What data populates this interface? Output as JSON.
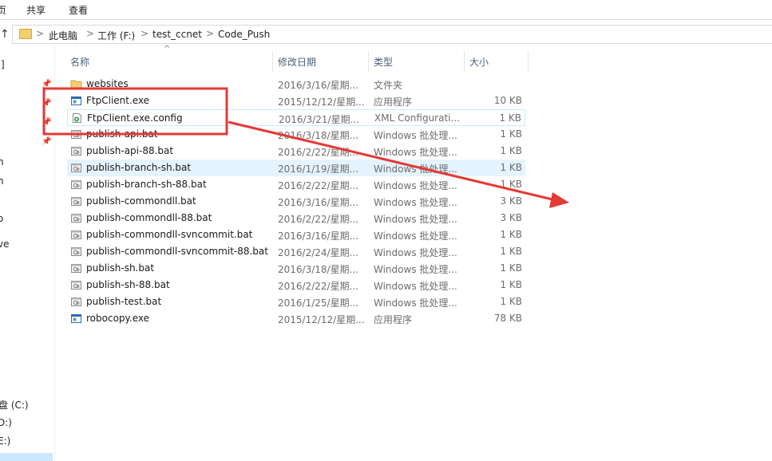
{
  "ribbon": {
    "tabs": [
      "页",
      "共享",
      "查看"
    ]
  },
  "address": {
    "up_glyph": "↑",
    "crumbs": [
      "此电脑",
      "工作 (F:)",
      "test_ccnet",
      "Code_Push"
    ],
    "separator": ">"
  },
  "nav": {
    "fragments": [
      "|]",
      "n",
      "n",
      "o",
      "ve",
      "盘 (C:)",
      "D:)",
      "E:)"
    ]
  },
  "columns": {
    "name": "名称",
    "date": "修改日期",
    "type": "类型",
    "size": "大小"
  },
  "files": [
    {
      "name": "websites",
      "date": "2016/3/16/星期...",
      "type": "文件夹",
      "size": "",
      "icon": "folder-icon"
    },
    {
      "name": "FtpClient.exe",
      "date": "2015/12/12/星期...",
      "type": "应用程序",
      "size": "10 KB",
      "icon": "exe-icon"
    },
    {
      "name": "FtpClient.exe.config",
      "date": "2016/3/21/星期...",
      "type": "XML Configurati...",
      "size": "1 KB",
      "icon": "config-icon"
    },
    {
      "name": "publish-api.bat",
      "date": "2016/3/18/星期...",
      "type": "Windows 批处理...",
      "size": "1 KB",
      "icon": "bat-icon"
    },
    {
      "name": "publish-api-88.bat",
      "date": "2016/2/22/星期...",
      "type": "Windows 批处理...",
      "size": "1 KB",
      "icon": "bat-icon"
    },
    {
      "name": "publish-branch-sh.bat",
      "date": "2016/1/19/星期...",
      "type": "Windows 批处理...",
      "size": "1 KB",
      "icon": "bat-icon"
    },
    {
      "name": "publish-branch-sh-88.bat",
      "date": "2016/2/22/星期...",
      "type": "Windows 批处理...",
      "size": "1 KB",
      "icon": "bat-icon"
    },
    {
      "name": "publish-commondll.bat",
      "date": "2016/3/16/星期...",
      "type": "Windows 批处理...",
      "size": "3 KB",
      "icon": "bat-icon"
    },
    {
      "name": "publish-commondll-88.bat",
      "date": "2016/2/22/星期...",
      "type": "Windows 批处理...",
      "size": "3 KB",
      "icon": "bat-icon"
    },
    {
      "name": "publish-commondll-svncommit.bat",
      "date": "2016/3/16/星期...",
      "type": "Windows 批处理...",
      "size": "1 KB",
      "icon": "bat-icon"
    },
    {
      "name": "publish-commondll-svncommit-88.bat",
      "date": "2016/2/24/星期...",
      "type": "Windows 批处理...",
      "size": "1 KB",
      "icon": "bat-icon"
    },
    {
      "name": "publish-sh.bat",
      "date": "2016/3/18/星期...",
      "type": "Windows 批处理...",
      "size": "1 KB",
      "icon": "bat-icon"
    },
    {
      "name": "publish-sh-88.bat",
      "date": "2016/2/22/星期...",
      "type": "Windows 批处理...",
      "size": "1 KB",
      "icon": "bat-icon"
    },
    {
      "name": "publish-test.bat",
      "date": "2016/1/25/星期...",
      "type": "Windows 批处理...",
      "size": "1 KB",
      "icon": "bat-icon"
    },
    {
      "name": "robocopy.exe",
      "date": "2015/12/12/星期...",
      "type": "应用程序",
      "size": "78 KB",
      "icon": "exe-icon"
    }
  ],
  "selected_row": "FtpClient.exe.config",
  "hover_row": "publish-branch-sh.bat",
  "annotation": {
    "color": "#e53935"
  },
  "colors": {
    "accent": "#cce8ff",
    "hover": "#e5f3ff",
    "header_text": "#4c607a"
  }
}
